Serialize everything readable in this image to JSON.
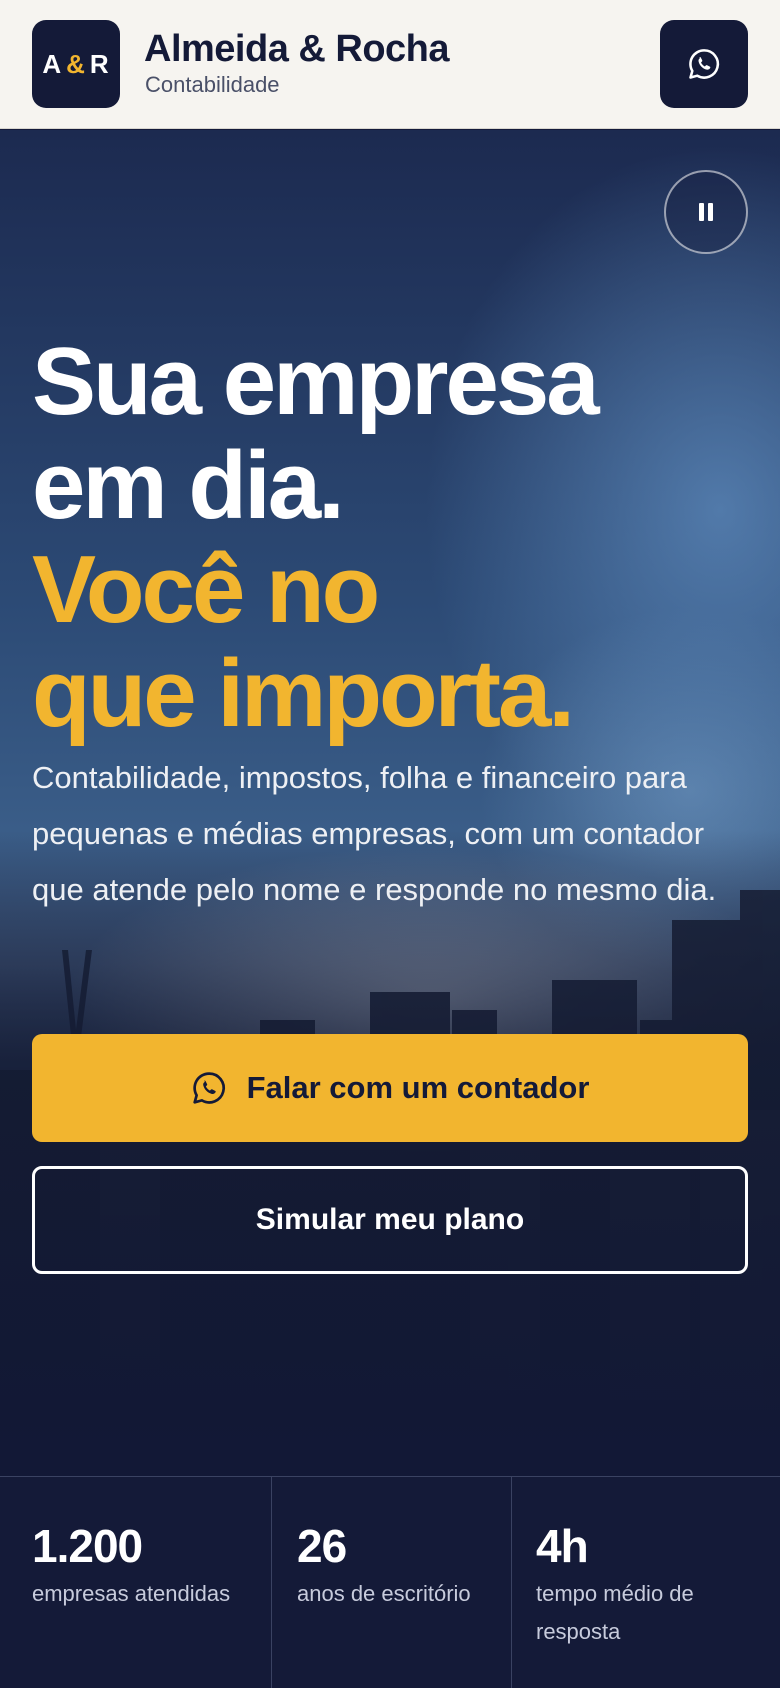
{
  "header": {
    "logo": {
      "left": "A",
      "amp": "&",
      "right": "R"
    },
    "brand_name": "Almeida & Rocha",
    "brand_sub": "Contabilidade",
    "whatsapp_icon": "whatsapp-icon"
  },
  "hero": {
    "pause_icon": "pause-icon",
    "headline": {
      "line1": "Sua empresa",
      "line2": "em dia.",
      "line3": "Você no",
      "line4": "que importa."
    },
    "lead": "Contabilidade, impostos, folha e financeiro para pequenas e médias empresas, com um contador que atende pelo nome e responde no mesmo dia.",
    "cta_primary": "Falar com um contador",
    "cta_secondary": "Simular meu plano"
  },
  "stats": [
    {
      "value": "1.200",
      "label": "empresas atendidas"
    },
    {
      "value": "26",
      "label": "anos de escritório"
    },
    {
      "value": "4h",
      "label": "tempo médio de resposta"
    }
  ],
  "colors": {
    "navy": "#141a38",
    "gold": "#f2b52f",
    "header_bg": "#f6f4f0"
  }
}
